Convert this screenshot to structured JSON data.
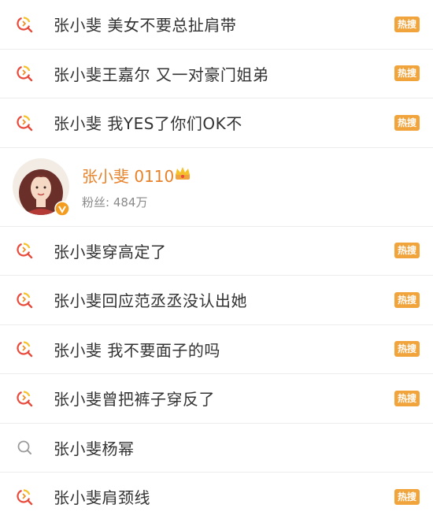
{
  "rows_top": [
    {
      "text": "张小斐 美女不要总扯肩带",
      "badge": "热搜",
      "icon": "hot-search-icon"
    },
    {
      "text": "张小斐王嘉尔 又一对豪门姐弟",
      "badge": "热搜",
      "icon": "hot-search-icon"
    },
    {
      "text": "张小斐 我YES了你们OK不",
      "badge": "热搜",
      "icon": "hot-search-icon"
    }
  ],
  "user": {
    "name": "张小斐 0110",
    "fans": "粉丝: 484万",
    "verified_icon": "verified-v-icon",
    "crown_icon": "crown-icon"
  },
  "rows_bottom": [
    {
      "text": "张小斐穿高定了",
      "badge": "热搜",
      "icon": "hot-search-icon"
    },
    {
      "text": "张小斐回应范丞丞没认出她",
      "badge": "热搜",
      "icon": "hot-search-icon"
    },
    {
      "text": "张小斐 我不要面子的吗",
      "badge": "热搜",
      "icon": "hot-search-icon"
    },
    {
      "text": "张小斐曾把裤子穿反了",
      "badge": "热搜",
      "icon": "hot-search-icon"
    },
    {
      "text": "张小斐杨幂",
      "badge": "",
      "icon": "search-icon"
    },
    {
      "text": "张小斐肩颈线",
      "badge": "热搜",
      "icon": "hot-search-icon"
    }
  ],
  "colors": {
    "badge": "#f1a43c",
    "username": "#e8822a",
    "hot_icon_orange": "#f08c1e",
    "hot_icon_red": "#e84a3b"
  }
}
